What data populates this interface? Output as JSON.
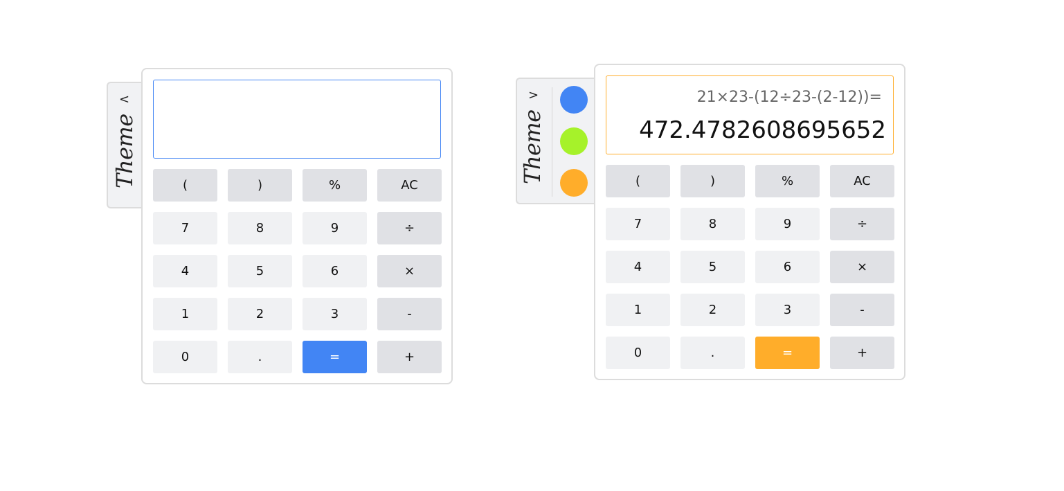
{
  "theme_label": "Theme",
  "calculators": [
    {
      "panel_chevron": "<",
      "accent_color": "#4285f4",
      "display": {
        "expression": "",
        "result": ""
      },
      "swatches": []
    },
    {
      "panel_chevron": ">",
      "accent_color": "#ffad2a",
      "display": {
        "expression": "21×23-(12÷23-(2-12))=",
        "result": "472.4782608695652"
      },
      "swatches": [
        {
          "name": "blue",
          "color": "#4285f4"
        },
        {
          "name": "green",
          "color": "#a6f22a"
        },
        {
          "name": "orange",
          "color": "#ffad2a"
        }
      ]
    }
  ],
  "keypad": [
    {
      "label": "(",
      "name": "open-paren",
      "style": "dark"
    },
    {
      "label": ")",
      "name": "close-paren",
      "style": "dark"
    },
    {
      "label": "%",
      "name": "percent",
      "style": "dark"
    },
    {
      "label": "AC",
      "name": "all-clear",
      "style": "dark"
    },
    {
      "label": "7",
      "name": "digit-7",
      "style": "light"
    },
    {
      "label": "8",
      "name": "digit-8",
      "style": "light"
    },
    {
      "label": "9",
      "name": "digit-9",
      "style": "light"
    },
    {
      "label": "÷",
      "name": "divide",
      "style": "dark"
    },
    {
      "label": "4",
      "name": "digit-4",
      "style": "light"
    },
    {
      "label": "5",
      "name": "digit-5",
      "style": "light"
    },
    {
      "label": "6",
      "name": "digit-6",
      "style": "light"
    },
    {
      "label": "×",
      "name": "multiply",
      "style": "dark"
    },
    {
      "label": "1",
      "name": "digit-1",
      "style": "light"
    },
    {
      "label": "2",
      "name": "digit-2",
      "style": "light"
    },
    {
      "label": "3",
      "name": "digit-3",
      "style": "light"
    },
    {
      "label": "-",
      "name": "subtract",
      "style": "dark"
    },
    {
      "label": "0",
      "name": "digit-0",
      "style": "light"
    },
    {
      "label": ".",
      "name": "decimal",
      "style": "light"
    },
    {
      "label": "=",
      "name": "equals",
      "style": "equals"
    },
    {
      "label": "+",
      "name": "add",
      "style": "dark"
    }
  ]
}
